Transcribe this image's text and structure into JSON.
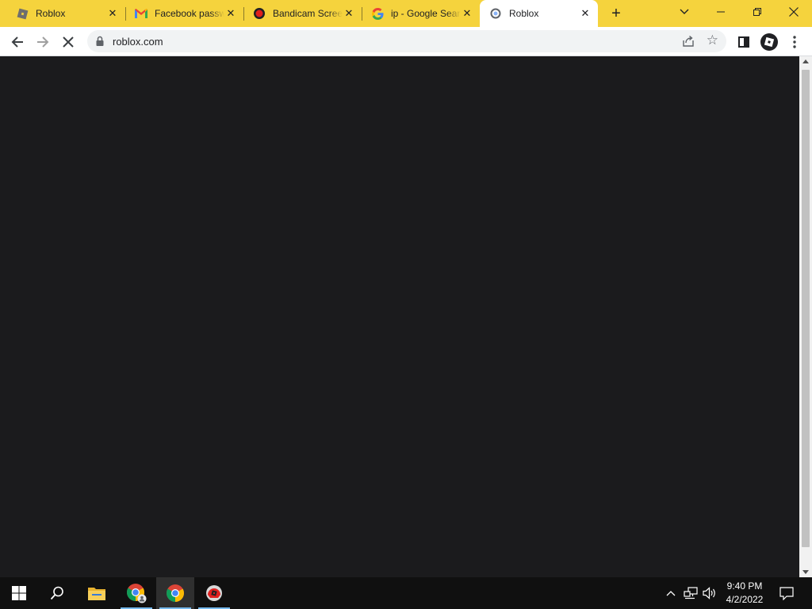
{
  "browser": {
    "tabs": [
      {
        "title": "Roblox",
        "icon": "roblox-icon"
      },
      {
        "title": "Facebook passw",
        "icon": "gmail-icon"
      },
      {
        "title": "Bandicam Scree",
        "icon": "bandicam-icon"
      },
      {
        "title": "ip - Google Sear",
        "icon": "google-icon"
      },
      {
        "title": "Roblox",
        "icon": "loading-icon",
        "active": true
      }
    ],
    "new_tab": "+",
    "close_glyph": "✕",
    "address": "roblox.com",
    "colors": {
      "tabstrip": "#f5d33d",
      "page": "#1b1b1d",
      "active_tab": "#ffffff"
    }
  },
  "taskbar": {
    "apps": [
      "start-icon",
      "search-icon",
      "file-explorer-icon",
      "chrome-profile-icon",
      "chrome-icon",
      "roblox-player-icon"
    ],
    "time": "9:40 PM",
    "date": "4/2/2022"
  }
}
